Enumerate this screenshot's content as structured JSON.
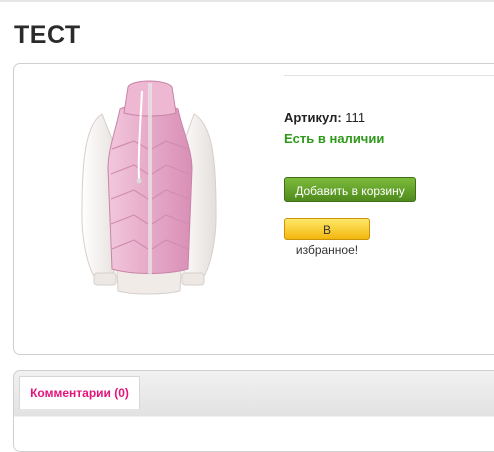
{
  "product": {
    "title": "ТЕСТ",
    "sku_label": "Артикул:",
    "sku_value": "111",
    "stock_status": "Есть в наличии",
    "add_to_cart": "Добавить в корзину",
    "add_to_favorites": "В избранное!"
  },
  "tabs": [
    {
      "label": "Комментарии (0)"
    }
  ],
  "colors": {
    "title": "#2b2b2b",
    "in_stock": "#2f9a19",
    "cart_button": "#5c9b24",
    "favorites_button": "#f7c523",
    "tab_active_text": "#e2147c",
    "jacket_body": "#e9b3cf",
    "sleeves": "#f5f1ef"
  },
  "image": {
    "subject": "pink quilted jacket with white sleeves"
  }
}
